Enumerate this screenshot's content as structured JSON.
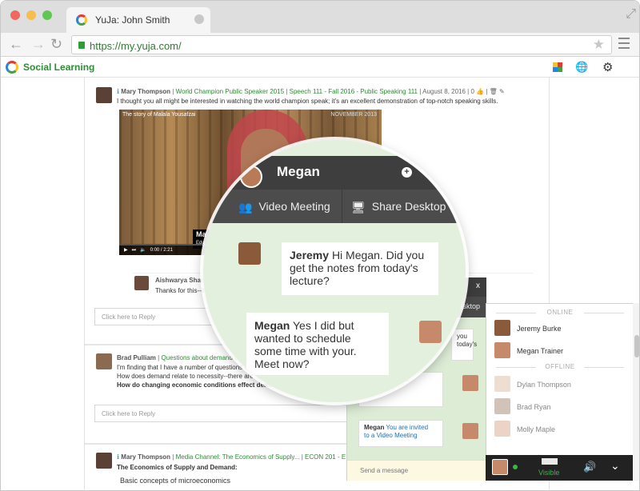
{
  "browser": {
    "tab_title": "YuJa: John Smith",
    "url": "https://my.yuja.com/",
    "traffic_lights": [
      "#ee6a5f",
      "#f5be4f",
      "#62c655"
    ]
  },
  "app": {
    "brand": "Social Learning",
    "accent": "#2e8c35",
    "header_icons": [
      "grid-apps-icon",
      "globe-icon",
      "gear-icon"
    ]
  },
  "feed": {
    "posts": [
      {
        "author": "Mary Thompson",
        "tags": [
          "World Champion Public Speaker 2015",
          "Speech 111 - Fall 2016 - Public Speaking 111"
        ],
        "date": "August 8, 2016",
        "likes": "0",
        "text": "I thought you all might be interested in watching the world champion speak; it's an excellent demonstration of top-notch speaking skills.",
        "video": {
          "title": "The story of Malala Yousafzai",
          "date": "NOVEMBER 2013",
          "overlay": "Ma",
          "overlay_sub": "Edu",
          "time": "0:00 / 2:21"
        },
        "comment": {
          "author": "Aishwarya Shan",
          "text": "Thanks for this--it"
        },
        "reply_placeholder": "Click here to Reply"
      },
      {
        "author": "Brad Pulliam",
        "tags": [
          "Questions about demand c"
        ],
        "lines": [
          "I'm finding that I have a number of questions a",
          "How does demand relate to necessity--there are",
          "How do changing economic conditions effect demand"
        ],
        "reply_placeholder": "Click here to Reply"
      },
      {
        "author": "Mary Thompson",
        "tags": [
          "Media Channel: The Economics of Supply...",
          "ECON 201 - E"
        ],
        "title": "The Economics of Supply and Demand:",
        "line": "Basic concepts of microeconomics"
      }
    ]
  },
  "chat_small": {
    "close": "x",
    "share_label": "esktop",
    "messages": [
      {
        "text": "you\ntoday's"
      },
      {
        "text": "e time with your.\nMeet now?"
      },
      {
        "sender": "Megan",
        "text": "You are invited\nto a Video Meeting"
      }
    ],
    "send_placeholder": "Send a message"
  },
  "contacts": {
    "online_header": "ONLINE",
    "offline_header": "OFFLINE",
    "online": [
      "Jeremy Burke",
      "Megan Trainer"
    ],
    "offline": [
      "Dylan Thompson",
      "Brad Ryan",
      "Molly Maple"
    ],
    "status": "Visible"
  },
  "magnified_chat": {
    "name": "Megan",
    "video_meeting": "Video Meeting",
    "share_desktop": "Share Desktop",
    "messages": [
      {
        "sender": "Jeremy",
        "text": "Hi Megan. Did you get the notes from today's lecture?"
      },
      {
        "sender": "Megan",
        "text": "Yes I did but wanted to schedule some time with your. Meet now?"
      }
    ]
  }
}
